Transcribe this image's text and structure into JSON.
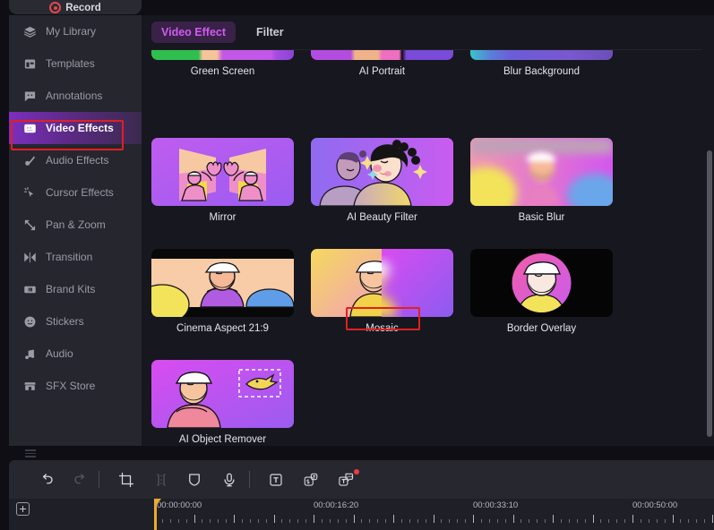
{
  "window": {
    "record_button_label": "Record",
    "bg_color": "#0e0e14",
    "panel_color": "#17171f",
    "sidebar_color": "#26262f",
    "accent_color": "#cf5cf0",
    "highlight_color": "#e02020"
  },
  "sidebar": {
    "items": [
      {
        "label": "My Library",
        "icon": "layers-icon",
        "active": false
      },
      {
        "label": "Templates",
        "icon": "template-icon",
        "active": false
      },
      {
        "label": "Annotations",
        "icon": "annotation-icon",
        "active": false
      },
      {
        "label": "Video Effects",
        "icon": "video-effects-icon",
        "active": true
      },
      {
        "label": "Audio Effects",
        "icon": "audio-effects-icon",
        "active": false
      },
      {
        "label": "Cursor Effects",
        "icon": "cursor-effects-icon",
        "active": false
      },
      {
        "label": "Pan & Zoom",
        "icon": "pan-zoom-icon",
        "active": false
      },
      {
        "label": "Transition",
        "icon": "transition-icon",
        "active": false
      },
      {
        "label": "Brand Kits",
        "icon": "brand-kits-icon",
        "active": false
      },
      {
        "label": "Stickers",
        "icon": "stickers-icon",
        "active": false
      },
      {
        "label": "Audio",
        "icon": "audio-icon",
        "active": false
      },
      {
        "label": "SFX Store",
        "icon": "sfx-store-icon",
        "active": false
      }
    ]
  },
  "panel": {
    "tabs": [
      {
        "label": "Video Effect",
        "selected": true
      },
      {
        "label": "Filter",
        "selected": false
      }
    ],
    "clipped_row": [
      {
        "label": "Green Screen"
      },
      {
        "label": "AI Portrait"
      },
      {
        "label": "Blur Background"
      }
    ],
    "effects": [
      {
        "label": "Mirror",
        "selected": false
      },
      {
        "label": "AI Beauty Filter",
        "selected": false
      },
      {
        "label": "Basic Blur",
        "selected": false
      },
      {
        "label": "Cinema Aspect 21:9",
        "selected": false
      },
      {
        "label": "Mosaic",
        "selected": true
      },
      {
        "label": "Border Overlay",
        "selected": false
      },
      {
        "label": "AI Object Remover",
        "selected": false
      }
    ]
  },
  "toolbar": {
    "buttons": [
      {
        "name": "undo-button",
        "icon": "undo-icon",
        "disabled": false
      },
      {
        "name": "redo-button",
        "icon": "redo-icon",
        "disabled": true
      },
      {
        "name": "crop-button",
        "icon": "crop-icon",
        "disabled": false
      },
      {
        "name": "split-button",
        "icon": "split-icon",
        "disabled": true
      },
      {
        "name": "shield-button",
        "icon": "shield-icon",
        "disabled": false
      },
      {
        "name": "voiceover-button",
        "icon": "microphone-icon",
        "disabled": false
      },
      {
        "name": "text-button",
        "icon": "text-icon",
        "disabled": false
      },
      {
        "name": "subtitle-button",
        "icon": "subtitle-icon",
        "disabled": false
      },
      {
        "name": "caption-button",
        "icon": "caption-icon",
        "disabled": false,
        "badge": true
      }
    ]
  },
  "timeline": {
    "add_track_label": "+",
    "timecodes": [
      "00:00:00:00",
      "00:00:16:20",
      "00:00:33:10",
      "00:00:50:00"
    ],
    "playhead_position": "00:00:00:00"
  }
}
